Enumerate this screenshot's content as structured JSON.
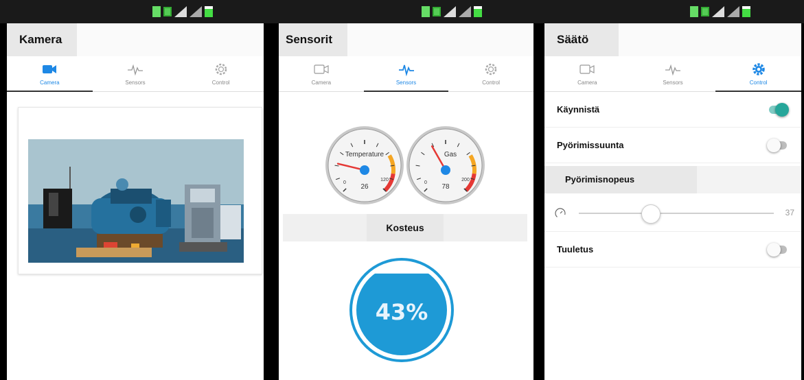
{
  "colors": {
    "accent": "#1e88e5",
    "toggle_on": "#26a69a",
    "humidity": "#1e9ad6"
  },
  "tabs": [
    {
      "label": "Camera",
      "icon": "videocam-icon"
    },
    {
      "label": "Sensors",
      "icon": "pulse-icon"
    },
    {
      "label": "Control",
      "icon": "gear-icon"
    }
  ],
  "camera_screen": {
    "title": "Kamera",
    "active_tab": 0
  },
  "sensors_screen": {
    "title": "Sensorit",
    "active_tab": 1,
    "gauges": [
      {
        "caption": "Temperature",
        "value": 26,
        "min": 0,
        "max": 120,
        "min_label": "0",
        "max_label": "120",
        "value_label": "26"
      },
      {
        "caption": "Gas",
        "value": 78,
        "min": 0,
        "max": 200,
        "min_label": "0",
        "max_label": "200",
        "value_label": "78"
      }
    ],
    "humidity_title": "Kosteus",
    "humidity_percent": 43,
    "humidity_label": "43%"
  },
  "control_screen": {
    "title": "Säätö",
    "active_tab": 2,
    "start_label": "Käynnistä",
    "start_on": true,
    "direction_label": "Pyörimissuunta",
    "direction_on": false,
    "speed_title": "Pyörimisnopeus",
    "speed_value": 37,
    "speed_value_label": "37",
    "speed_max": 100,
    "ventilation_label": "Tuuletus",
    "ventilation_on": false
  }
}
